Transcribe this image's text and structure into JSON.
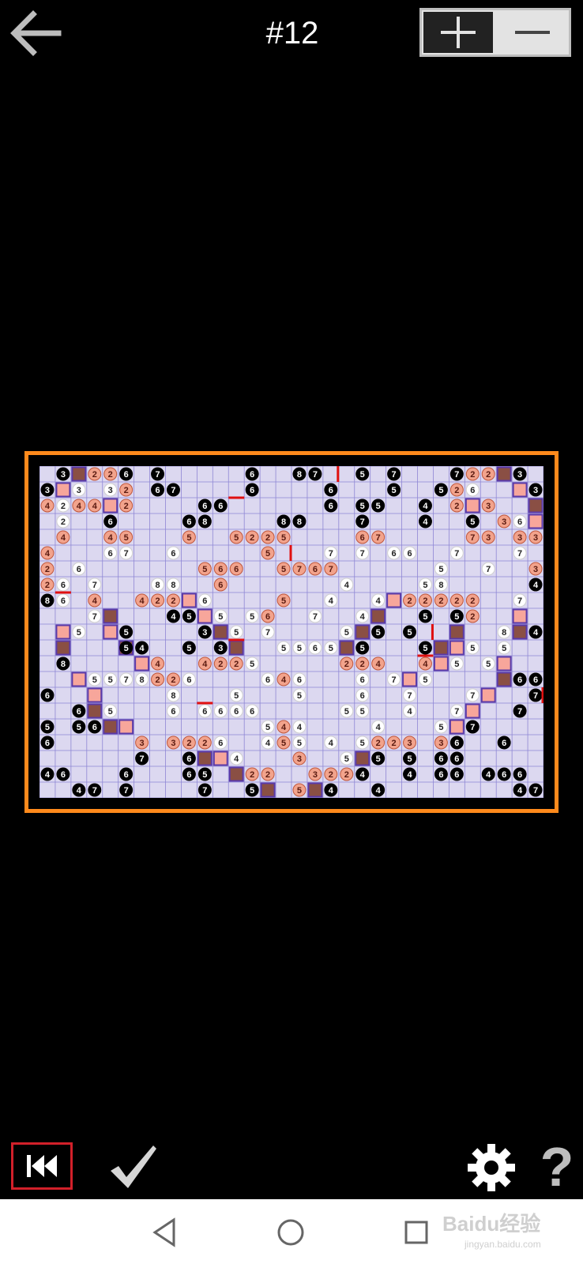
{
  "header": {
    "title": "#12",
    "back_icon": "arrow-left-icon",
    "zoom_in_icon": "plus-icon",
    "zoom_out_icon": "minus-icon"
  },
  "board": {
    "cols": 32,
    "rows": 21,
    "colors": {
      "grid_bg": "#dcd8f0",
      "grid_line": "#8e86d4",
      "frame": "#ff8a1c",
      "dark_cell": "#8a4f44",
      "light_cell": "#f7a69b",
      "wall": "#e01010",
      "pink_clue": "#f2a38c",
      "white_clue": "#ffffff",
      "black_clue": "#000000"
    },
    "clues": [
      [
        0,
        1,
        3,
        "b"
      ],
      [
        0,
        3,
        2,
        "p"
      ],
      [
        0,
        4,
        2,
        "p"
      ],
      [
        0,
        5,
        6,
        "b"
      ],
      [
        0,
        7,
        7,
        "b"
      ],
      [
        0,
        13,
        6,
        "b"
      ],
      [
        0,
        16,
        8,
        "b"
      ],
      [
        0,
        17,
        7,
        "b"
      ],
      [
        0,
        20,
        5,
        "b"
      ],
      [
        0,
        22,
        7,
        "b"
      ],
      [
        0,
        26,
        7,
        "b"
      ],
      [
        0,
        27,
        2,
        "p"
      ],
      [
        0,
        28,
        2,
        "p"
      ],
      [
        0,
        30,
        3,
        "b"
      ],
      [
        1,
        0,
        3,
        "b"
      ],
      [
        1,
        2,
        3,
        "w"
      ],
      [
        1,
        4,
        3,
        "w"
      ],
      [
        1,
        5,
        2,
        "p"
      ],
      [
        1,
        7,
        6,
        "b"
      ],
      [
        1,
        8,
        7,
        "b"
      ],
      [
        1,
        13,
        6,
        "b"
      ],
      [
        1,
        18,
        6,
        "b"
      ],
      [
        1,
        22,
        5,
        "b"
      ],
      [
        1,
        25,
        5,
        "b"
      ],
      [
        1,
        26,
        2,
        "p"
      ],
      [
        1,
        27,
        6,
        "w"
      ],
      [
        1,
        31,
        3,
        "b"
      ],
      [
        2,
        0,
        4,
        "p"
      ],
      [
        2,
        1,
        2,
        "w"
      ],
      [
        2,
        2,
        4,
        "p"
      ],
      [
        2,
        3,
        4,
        "p"
      ],
      [
        2,
        5,
        2,
        "p"
      ],
      [
        2,
        10,
        6,
        "b"
      ],
      [
        2,
        11,
        6,
        "b"
      ],
      [
        2,
        18,
        6,
        "b"
      ],
      [
        2,
        20,
        5,
        "b"
      ],
      [
        2,
        21,
        5,
        "b"
      ],
      [
        2,
        24,
        4,
        "b"
      ],
      [
        2,
        26,
        2,
        "p"
      ],
      [
        2,
        28,
        3,
        "p"
      ],
      [
        3,
        1,
        2,
        "w"
      ],
      [
        3,
        4,
        6,
        "b"
      ],
      [
        3,
        9,
        6,
        "b"
      ],
      [
        3,
        10,
        8,
        "b"
      ],
      [
        3,
        15,
        8,
        "b"
      ],
      [
        3,
        16,
        8,
        "b"
      ],
      [
        3,
        20,
        7,
        "b"
      ],
      [
        3,
        24,
        4,
        "b"
      ],
      [
        3,
        27,
        5,
        "b"
      ],
      [
        3,
        29,
        3,
        "p"
      ],
      [
        3,
        30,
        6,
        "w"
      ],
      [
        4,
        1,
        4,
        "p"
      ],
      [
        4,
        4,
        4,
        "p"
      ],
      [
        4,
        5,
        5,
        "p"
      ],
      [
        4,
        9,
        5,
        "p"
      ],
      [
        4,
        12,
        5,
        "p"
      ],
      [
        4,
        13,
        2,
        "p"
      ],
      [
        4,
        14,
        2,
        "p"
      ],
      [
        4,
        15,
        5,
        "p"
      ],
      [
        4,
        20,
        6,
        "p"
      ],
      [
        4,
        21,
        7,
        "p"
      ],
      [
        4,
        27,
        7,
        "p"
      ],
      [
        4,
        28,
        3,
        "p"
      ],
      [
        4,
        30,
        3,
        "p"
      ],
      [
        4,
        31,
        3,
        "p"
      ],
      [
        5,
        0,
        4,
        "p"
      ],
      [
        5,
        4,
        6,
        "w"
      ],
      [
        5,
        5,
        7,
        "w"
      ],
      [
        5,
        8,
        6,
        "w"
      ],
      [
        5,
        14,
        5,
        "p"
      ],
      [
        5,
        18,
        7,
        "w"
      ],
      [
        5,
        20,
        7,
        "w"
      ],
      [
        5,
        22,
        6,
        "w"
      ],
      [
        5,
        23,
        6,
        "w"
      ],
      [
        5,
        26,
        7,
        "w"
      ],
      [
        5,
        30,
        7,
        "w"
      ],
      [
        6,
        0,
        2,
        "p"
      ],
      [
        6,
        2,
        6,
        "w"
      ],
      [
        6,
        10,
        5,
        "p"
      ],
      [
        6,
        11,
        6,
        "p"
      ],
      [
        6,
        12,
        6,
        "p"
      ],
      [
        6,
        15,
        5,
        "p"
      ],
      [
        6,
        16,
        7,
        "p"
      ],
      [
        6,
        17,
        6,
        "p"
      ],
      [
        6,
        18,
        7,
        "p"
      ],
      [
        6,
        25,
        5,
        "w"
      ],
      [
        6,
        28,
        7,
        "w"
      ],
      [
        6,
        31,
        3,
        "p"
      ],
      [
        7,
        0,
        2,
        "p"
      ],
      [
        7,
        1,
        6,
        "w"
      ],
      [
        7,
        3,
        7,
        "w"
      ],
      [
        7,
        7,
        8,
        "w"
      ],
      [
        7,
        8,
        8,
        "w"
      ],
      [
        7,
        11,
        6,
        "p"
      ],
      [
        7,
        19,
        4,
        "w"
      ],
      [
        7,
        24,
        5,
        "w"
      ],
      [
        7,
        25,
        8,
        "w"
      ],
      [
        7,
        31,
        4,
        "b"
      ],
      [
        8,
        0,
        8,
        "b"
      ],
      [
        8,
        1,
        6,
        "w"
      ],
      [
        8,
        3,
        4,
        "p"
      ],
      [
        8,
        6,
        4,
        "p"
      ],
      [
        8,
        7,
        2,
        "p"
      ],
      [
        8,
        8,
        2,
        "p"
      ],
      [
        8,
        10,
        6,
        "w"
      ],
      [
        8,
        15,
        5,
        "p"
      ],
      [
        8,
        18,
        4,
        "w"
      ],
      [
        8,
        21,
        4,
        "w"
      ],
      [
        8,
        23,
        2,
        "p"
      ],
      [
        8,
        24,
        2,
        "p"
      ],
      [
        8,
        25,
        2,
        "p"
      ],
      [
        8,
        26,
        2,
        "p"
      ],
      [
        8,
        27,
        2,
        "p"
      ],
      [
        8,
        30,
        7,
        "w"
      ],
      [
        9,
        3,
        7,
        "w"
      ],
      [
        9,
        8,
        4,
        "b"
      ],
      [
        9,
        9,
        5,
        "b"
      ],
      [
        9,
        11,
        5,
        "w"
      ],
      [
        9,
        13,
        5,
        "w"
      ],
      [
        9,
        14,
        6,
        "p"
      ],
      [
        9,
        17,
        7,
        "w"
      ],
      [
        9,
        20,
        4,
        "w"
      ],
      [
        9,
        24,
        5,
        "b"
      ],
      [
        9,
        26,
        5,
        "b"
      ],
      [
        9,
        27,
        2,
        "p"
      ],
      [
        10,
        2,
        5,
        "w"
      ],
      [
        10,
        5,
        5,
        "b"
      ],
      [
        10,
        10,
        3,
        "b"
      ],
      [
        10,
        12,
        5,
        "w"
      ],
      [
        10,
        14,
        7,
        "w"
      ],
      [
        10,
        19,
        5,
        "w"
      ],
      [
        10,
        21,
        5,
        "b"
      ],
      [
        10,
        23,
        5,
        "b"
      ],
      [
        10,
        29,
        8,
        "w"
      ],
      [
        10,
        31,
        4,
        "b"
      ],
      [
        11,
        5,
        5,
        "b"
      ],
      [
        11,
        6,
        4,
        "b"
      ],
      [
        11,
        9,
        5,
        "b"
      ],
      [
        11,
        11,
        3,
        "b"
      ],
      [
        11,
        15,
        5,
        "w"
      ],
      [
        11,
        16,
        5,
        "w"
      ],
      [
        11,
        17,
        6,
        "w"
      ],
      [
        11,
        18,
        5,
        "w"
      ],
      [
        11,
        20,
        5,
        "b"
      ],
      [
        11,
        24,
        5,
        "b"
      ],
      [
        11,
        27,
        5,
        "w"
      ],
      [
        11,
        29,
        5,
        "w"
      ],
      [
        12,
        1,
        8,
        "b"
      ],
      [
        12,
        7,
        4,
        "p"
      ],
      [
        12,
        10,
        4,
        "p"
      ],
      [
        12,
        11,
        2,
        "p"
      ],
      [
        12,
        12,
        2,
        "p"
      ],
      [
        12,
        13,
        5,
        "w"
      ],
      [
        12,
        19,
        2,
        "p"
      ],
      [
        12,
        20,
        2,
        "p"
      ],
      [
        12,
        21,
        4,
        "p"
      ],
      [
        12,
        24,
        4,
        "p"
      ],
      [
        12,
        26,
        5,
        "w"
      ],
      [
        12,
        28,
        5,
        "w"
      ],
      [
        13,
        3,
        5,
        "w"
      ],
      [
        13,
        4,
        5,
        "w"
      ],
      [
        13,
        5,
        7,
        "w"
      ],
      [
        13,
        6,
        8,
        "w"
      ],
      [
        13,
        7,
        2,
        "p"
      ],
      [
        13,
        8,
        2,
        "p"
      ],
      [
        13,
        9,
        6,
        "w"
      ],
      [
        13,
        14,
        6,
        "w"
      ],
      [
        13,
        15,
        4,
        "p"
      ],
      [
        13,
        16,
        6,
        "w"
      ],
      [
        13,
        20,
        6,
        "w"
      ],
      [
        13,
        22,
        7,
        "w"
      ],
      [
        13,
        24,
        5,
        "w"
      ],
      [
        13,
        30,
        6,
        "b"
      ],
      [
        13,
        31,
        6,
        "b"
      ],
      [
        14,
        0,
        6,
        "b"
      ],
      [
        14,
        8,
        8,
        "w"
      ],
      [
        14,
        12,
        5,
        "w"
      ],
      [
        14,
        16,
        5,
        "w"
      ],
      [
        14,
        20,
        6,
        "w"
      ],
      [
        14,
        23,
        7,
        "w"
      ],
      [
        14,
        27,
        7,
        "w"
      ],
      [
        14,
        31,
        7,
        "b"
      ],
      [
        15,
        2,
        6,
        "b"
      ],
      [
        15,
        4,
        5,
        "w"
      ],
      [
        15,
        8,
        6,
        "w"
      ],
      [
        15,
        10,
        6,
        "w"
      ],
      [
        15,
        11,
        6,
        "w"
      ],
      [
        15,
        12,
        6,
        "w"
      ],
      [
        15,
        13,
        6,
        "w"
      ],
      [
        15,
        19,
        5,
        "w"
      ],
      [
        15,
        20,
        5,
        "w"
      ],
      [
        15,
        23,
        4,
        "w"
      ],
      [
        15,
        26,
        7,
        "w"
      ],
      [
        15,
        30,
        7,
        "b"
      ],
      [
        16,
        0,
        5,
        "b"
      ],
      [
        16,
        2,
        5,
        "b"
      ],
      [
        16,
        3,
        6,
        "b"
      ],
      [
        16,
        14,
        5,
        "w"
      ],
      [
        16,
        15,
        4,
        "p"
      ],
      [
        16,
        16,
        4,
        "w"
      ],
      [
        16,
        21,
        4,
        "w"
      ],
      [
        16,
        25,
        5,
        "w"
      ],
      [
        16,
        27,
        7,
        "b"
      ],
      [
        17,
        0,
        6,
        "b"
      ],
      [
        17,
        6,
        3,
        "p"
      ],
      [
        17,
        8,
        3,
        "p"
      ],
      [
        17,
        9,
        2,
        "p"
      ],
      [
        17,
        10,
        2,
        "p"
      ],
      [
        17,
        11,
        6,
        "w"
      ],
      [
        17,
        14,
        4,
        "w"
      ],
      [
        17,
        15,
        5,
        "p"
      ],
      [
        17,
        16,
        5,
        "w"
      ],
      [
        17,
        18,
        4,
        "w"
      ],
      [
        17,
        20,
        5,
        "w"
      ],
      [
        17,
        21,
        2,
        "p"
      ],
      [
        17,
        22,
        2,
        "p"
      ],
      [
        17,
        23,
        3,
        "p"
      ],
      [
        17,
        25,
        3,
        "p"
      ],
      [
        17,
        26,
        6,
        "b"
      ],
      [
        17,
        29,
        6,
        "b"
      ],
      [
        18,
        6,
        7,
        "b"
      ],
      [
        18,
        9,
        6,
        "b"
      ],
      [
        18,
        12,
        4,
        "w"
      ],
      [
        18,
        16,
        3,
        "p"
      ],
      [
        18,
        19,
        5,
        "w"
      ],
      [
        18,
        21,
        5,
        "b"
      ],
      [
        18,
        23,
        5,
        "b"
      ],
      [
        18,
        25,
        6,
        "b"
      ],
      [
        18,
        26,
        6,
        "b"
      ],
      [
        19,
        0,
        4,
        "b"
      ],
      [
        19,
        1,
        6,
        "b"
      ],
      [
        19,
        5,
        6,
        "b"
      ],
      [
        19,
        9,
        6,
        "b"
      ],
      [
        19,
        10,
        5,
        "b"
      ],
      [
        19,
        13,
        2,
        "p"
      ],
      [
        19,
        14,
        2,
        "p"
      ],
      [
        19,
        17,
        3,
        "p"
      ],
      [
        19,
        18,
        2,
        "p"
      ],
      [
        19,
        19,
        2,
        "p"
      ],
      [
        19,
        20,
        4,
        "b"
      ],
      [
        19,
        23,
        4,
        "b"
      ],
      [
        19,
        25,
        6,
        "b"
      ],
      [
        19,
        26,
        6,
        "b"
      ],
      [
        19,
        28,
        4,
        "b"
      ],
      [
        19,
        29,
        6,
        "b"
      ],
      [
        19,
        30,
        6,
        "b"
      ],
      [
        20,
        2,
        4,
        "b"
      ],
      [
        20,
        3,
        7,
        "b"
      ],
      [
        20,
        5,
        7,
        "b"
      ],
      [
        20,
        10,
        7,
        "b"
      ],
      [
        20,
        13,
        5,
        "b"
      ],
      [
        20,
        16,
        5,
        "p"
      ],
      [
        20,
        18,
        4,
        "b"
      ],
      [
        20,
        21,
        4,
        "b"
      ],
      [
        20,
        30,
        4,
        "b"
      ],
      [
        20,
        31,
        7,
        "b"
      ]
    ],
    "filled": [
      [
        0,
        2,
        "d"
      ],
      [
        0,
        29,
        "d"
      ],
      [
        1,
        1,
        "l"
      ],
      [
        1,
        30,
        "l"
      ],
      [
        2,
        4,
        "l"
      ],
      [
        2,
        27,
        "l"
      ],
      [
        2,
        31,
        "d"
      ],
      [
        3,
        31,
        "l"
      ],
      [
        8,
        9,
        "l"
      ],
      [
        8,
        22,
        "l"
      ],
      [
        9,
        10,
        "l"
      ],
      [
        9,
        4,
        "d"
      ],
      [
        9,
        21,
        "d"
      ],
      [
        9,
        30,
        "l"
      ],
      [
        10,
        1,
        "l"
      ],
      [
        10,
        4,
        "l"
      ],
      [
        10,
        11,
        "d"
      ],
      [
        10,
        20,
        "d"
      ],
      [
        10,
        26,
        "d"
      ],
      [
        10,
        30,
        "d"
      ],
      [
        11,
        1,
        "d"
      ],
      [
        11,
        5,
        "d"
      ],
      [
        11,
        12,
        "d"
      ],
      [
        11,
        19,
        "d"
      ],
      [
        11,
        25,
        "d"
      ],
      [
        11,
        26,
        "l"
      ],
      [
        12,
        6,
        "l"
      ],
      [
        12,
        25,
        "l"
      ],
      [
        12,
        29,
        "l"
      ],
      [
        13,
        2,
        "l"
      ],
      [
        13,
        23,
        "l"
      ],
      [
        13,
        29,
        "d"
      ],
      [
        14,
        3,
        "l"
      ],
      [
        14,
        28,
        "l"
      ],
      [
        15,
        3,
        "d"
      ],
      [
        15,
        27,
        "l"
      ],
      [
        16,
        4,
        "d"
      ],
      [
        16,
        5,
        "l"
      ],
      [
        16,
        26,
        "l"
      ],
      [
        18,
        10,
        "d"
      ],
      [
        18,
        11,
        "l"
      ],
      [
        18,
        20,
        "d"
      ],
      [
        19,
        12,
        "d"
      ],
      [
        20,
        14,
        "d"
      ],
      [
        20,
        17,
        "d"
      ]
    ],
    "walls": [
      [
        0,
        18,
        "v"
      ],
      [
        1,
        12,
        "h"
      ],
      [
        5,
        15,
        "v"
      ],
      [
        7,
        1,
        "h"
      ],
      [
        10,
        12,
        "h"
      ],
      [
        10,
        24,
        "v"
      ],
      [
        11,
        24,
        "h"
      ],
      [
        14,
        10,
        "h"
      ],
      [
        14,
        31,
        "v"
      ]
    ]
  },
  "footer": {
    "restart_icon": "skip-back-icon",
    "check_icon": "checkmark-icon",
    "settings_icon": "gear-icon",
    "help_label": "?"
  },
  "system_nav": {
    "back_icon": "triangle-back-icon",
    "home_icon": "circle-home-icon",
    "recents_icon": "square-recents-icon"
  },
  "watermark": {
    "text": "Baidu经验",
    "sub": "jingyan.baidu.com"
  }
}
